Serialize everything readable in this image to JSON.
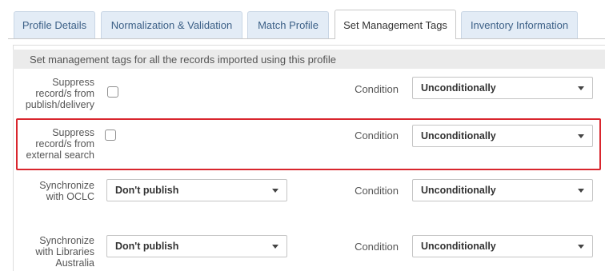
{
  "tabs": [
    {
      "label": "Profile Details"
    },
    {
      "label": "Normalization & Validation"
    },
    {
      "label": "Match Profile"
    },
    {
      "label": "Set Management Tags",
      "active": true
    },
    {
      "label": "Inventory Information"
    }
  ],
  "panel": {
    "header": "Set management tags for all the records imported using this profile"
  },
  "rows": [
    {
      "label_lines": [
        "Suppress",
        "record/s from",
        "publish/delivery"
      ],
      "checked": false,
      "condition_label": "Condition",
      "condition_value": "Unconditionally"
    },
    {
      "label_lines": [
        "Suppress",
        "record/s from",
        "external search"
      ],
      "checked": false,
      "condition_label": "Condition",
      "condition_value": "Unconditionally"
    },
    {
      "label_lines": [
        "Synchronize",
        "with OCLC"
      ],
      "publish_value": "Don't publish",
      "condition_label": "Condition",
      "condition_value": "Unconditionally"
    },
    {
      "label_lines": [
        "Synchronize",
        "with Libraries",
        "Australia"
      ],
      "publish_value": "Don't publish",
      "condition_label": "Condition",
      "condition_value": "Unconditionally"
    }
  ],
  "colors": {
    "highlight_border": "#d9262e",
    "tab_inactive_bg": "#e3ecf6",
    "tab_inactive_text": "#3b5f86"
  }
}
